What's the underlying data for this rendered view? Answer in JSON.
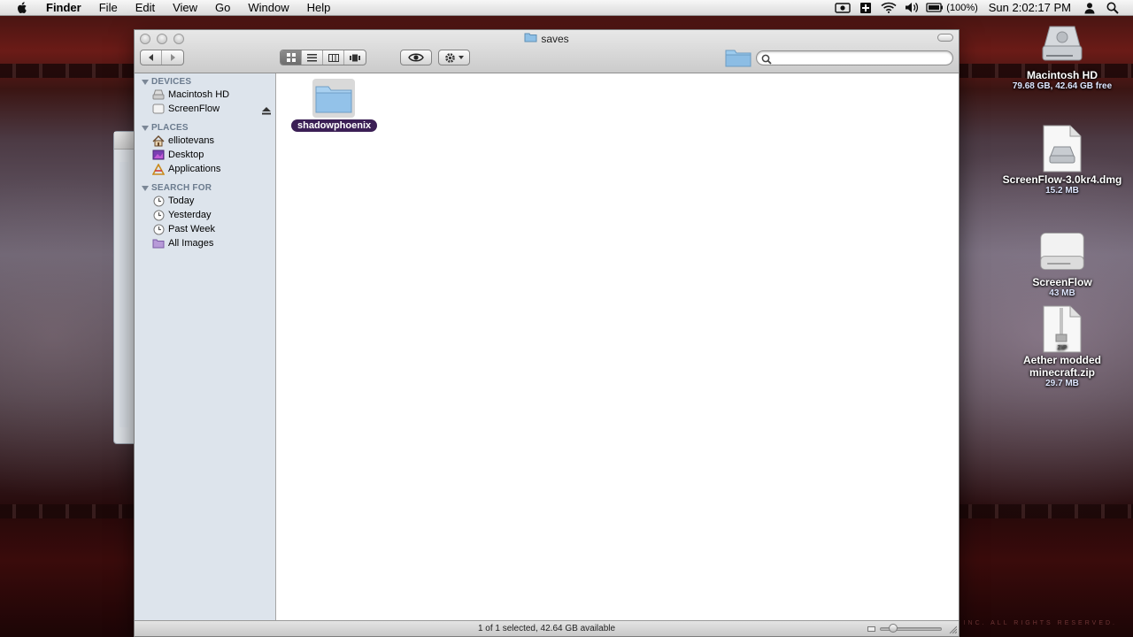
{
  "menubar": {
    "app_name": "Finder",
    "items": [
      "File",
      "Edit",
      "View",
      "Go",
      "Window",
      "Help"
    ],
    "battery": "(100%)",
    "clock": "Sun 2:02:17 PM"
  },
  "finder": {
    "title": "saves",
    "search": {
      "placeholder": "",
      "value": ""
    },
    "sidebar": {
      "devices_header": "DEVICES",
      "devices": [
        "Macintosh HD",
        "ScreenFlow"
      ],
      "places_header": "PLACES",
      "places": [
        "elliotevans",
        "Desktop",
        "Applications"
      ],
      "search_header": "SEARCH FOR",
      "searches": [
        "Today",
        "Yesterday",
        "Past Week",
        "All Images"
      ]
    },
    "items": [
      {
        "name": "shadowphoenix",
        "selected": true
      }
    ],
    "status": "1 of 1 selected, 42.64 GB available"
  },
  "desktop": {
    "icons": [
      {
        "name": "Macintosh HD",
        "sub": "79.68 GB, 42.64 GB free",
        "icon": "hard-drive-icon"
      },
      {
        "name": "ScreenFlow-3.0kr4.dmg",
        "sub": "15.2 MB",
        "icon": "dmg-file-icon"
      },
      {
        "name": "ScreenFlow",
        "sub": "43 MB",
        "icon": "mounted-volume-icon"
      },
      {
        "name": "Aether modded minecraft.zip",
        "sub": "29.7 MB",
        "icon": "zip-file-icon"
      }
    ],
    "wallpaper_text": "INC. ALL RIGHTS RESERVED."
  },
  "colors": {
    "selection_label": "#3b1f55",
    "sidebar_bg": "#dde4ec",
    "folder_blue": "#8fc0e6"
  }
}
